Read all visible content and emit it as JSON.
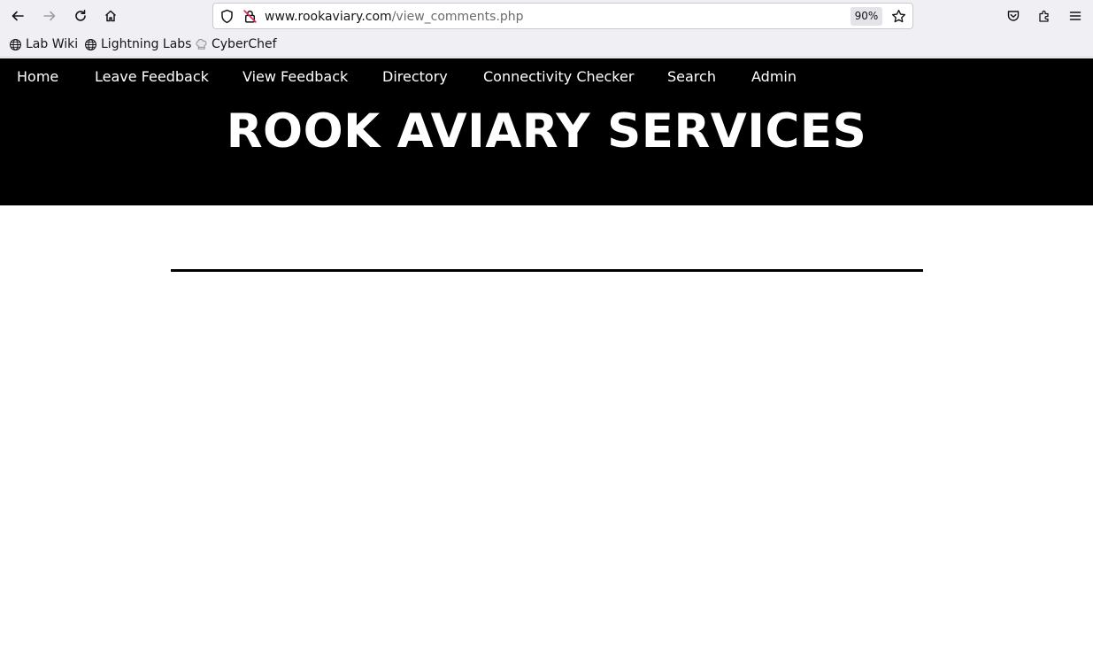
{
  "browser": {
    "url_host": "www.rookaviary.com",
    "url_path": "/view_comments.php",
    "zoom": "90%",
    "toolbar_icons": [
      "back-icon",
      "forward-icon",
      "reload-icon",
      "home-icon",
      "shield-icon",
      "lock-insecure-icon",
      "star-icon",
      "pocket-icon",
      "extensions-icon",
      "menu-icon"
    ],
    "bookmarks": [
      {
        "label": "Lab Wiki",
        "icon": "globe-icon"
      },
      {
        "label": "Lightning Labs",
        "icon": "globe-icon"
      },
      {
        "label": "CyberChef",
        "icon": "chef-icon"
      }
    ]
  },
  "site": {
    "nav": [
      {
        "label": "Home"
      },
      {
        "label": "Leave Feedback"
      },
      {
        "label": "View Feedback"
      },
      {
        "label": "Directory"
      },
      {
        "label": "Connectivity Checker"
      },
      {
        "label": "Search"
      },
      {
        "label": "Admin"
      }
    ],
    "title": "ROOK AVIARY SERVICES"
  },
  "colors": {
    "header_bg": "#000000",
    "header_text": "#ffffff",
    "chrome_bg": "#f0f0f4"
  }
}
